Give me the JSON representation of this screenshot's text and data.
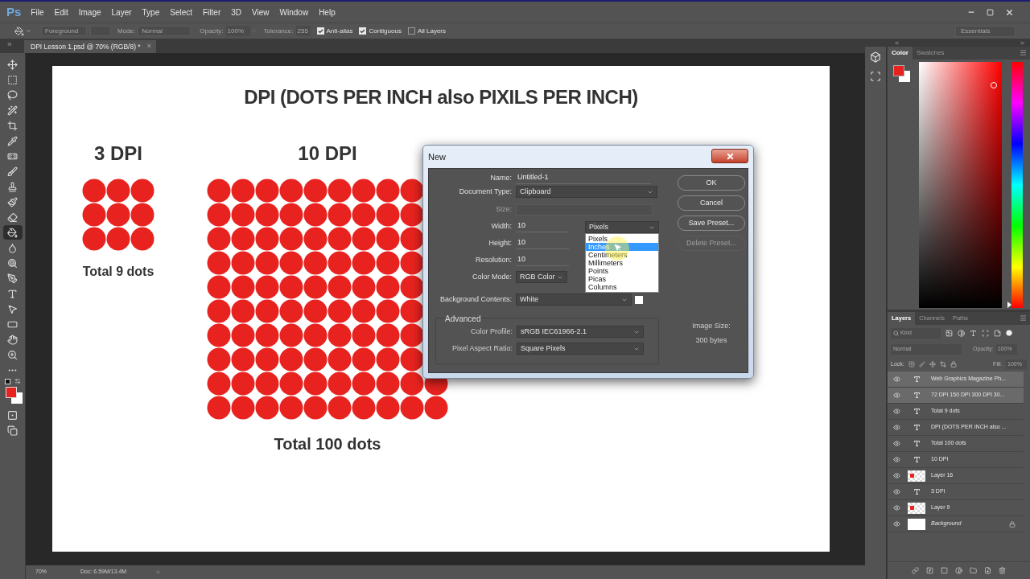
{
  "app": {
    "logo": "Ps",
    "menu": [
      "File",
      "Edit",
      "Image",
      "Layer",
      "Type",
      "Select",
      "Filter",
      "3D",
      "View",
      "Window",
      "Help"
    ]
  },
  "options_bar": {
    "preset": "Foreground",
    "mode_label": "Mode:",
    "mode": "Normal",
    "opacity_label": "Opacity:",
    "opacity": "100%",
    "tolerance_label": "Tolerance:",
    "tolerance": "255",
    "checkboxes": [
      {
        "label": "Anti-alias",
        "checked": true
      },
      {
        "label": "Contiguous",
        "checked": true
      },
      {
        "label": "All Layers",
        "checked": false
      }
    ],
    "workspace": "Essentials"
  },
  "document_tab": {
    "title": "DPI Lesson 1.psd @ 70% (RGB/8) *",
    "close": "×"
  },
  "tools": [
    {
      "kind": "move",
      "selected": false
    },
    {
      "kind": "marquee",
      "selected": false
    },
    {
      "kind": "lasso",
      "selected": false
    },
    {
      "kind": "quick_selection",
      "selected": false
    },
    {
      "kind": "crop",
      "selected": false
    },
    {
      "kind": "eyedropper",
      "selected": false
    },
    {
      "kind": "healing",
      "selected": false
    },
    {
      "kind": "brush",
      "selected": false
    },
    {
      "kind": "stamp",
      "selected": false
    },
    {
      "kind": "history_brush",
      "selected": false
    },
    {
      "kind": "eraser",
      "selected": false
    },
    {
      "kind": "paint_bucket",
      "selected": true
    },
    {
      "kind": "blur",
      "selected": false
    },
    {
      "kind": "dodge",
      "selected": false
    },
    {
      "kind": "pen",
      "selected": false
    },
    {
      "kind": "type",
      "selected": false
    },
    {
      "kind": "path_selection",
      "selected": false
    },
    {
      "kind": "rectangle",
      "selected": false
    },
    {
      "kind": "hand",
      "selected": false
    },
    {
      "kind": "zoom",
      "selected": false
    },
    {
      "kind": "more",
      "selected": false
    },
    {
      "kind": "colors",
      "selected": false
    },
    {
      "kind": "quick_mask",
      "selected": false
    },
    {
      "kind": "screen_mode",
      "selected": false
    }
  ],
  "document": {
    "title": "DPI (DOTS PER INCH also PIXILS PER INCH)",
    "examples": [
      {
        "heading": "3 DPI",
        "kind": "small",
        "total": "Total 9 dots"
      },
      {
        "heading": "10 DPI",
        "kind": "large",
        "total": "Total 100 dots"
      }
    ]
  },
  "dialog": {
    "title": "New",
    "name": {
      "label": "Name:",
      "value": "Untitled-1"
    },
    "document_type": {
      "label": "Document Type:",
      "value": "Clipboard"
    },
    "size": {
      "label": "Size:",
      "disabled": true
    },
    "width": {
      "label": "Width:",
      "value": "10",
      "unit": "Pixels",
      "unit_options": [
        {
          "label": "Pixels",
          "selected": false
        },
        {
          "label": "Inches",
          "selected": true
        },
        {
          "label": "Centimeters",
          "selected": false
        },
        {
          "label": "Millimeters",
          "selected": false
        },
        {
          "label": "Points",
          "selected": false
        },
        {
          "label": "Picas",
          "selected": false
        },
        {
          "label": "Columns",
          "selected": false
        }
      ]
    },
    "height": {
      "label": "Height:",
      "value": "10"
    },
    "resolution": {
      "label": "Resolution:",
      "value": "10"
    },
    "color_mode": {
      "label": "Color Mode:",
      "value": "RGB Color"
    },
    "background": {
      "label": "Background Contents:",
      "value": "White"
    },
    "advanced": {
      "title": "Advanced",
      "color_profile": {
        "label": "Color Profile:",
        "value": "sRGB IEC61966-2.1"
      },
      "pixel_aspect_ratio": {
        "label": "Pixel Aspect Ratio:",
        "value": "Square Pixels"
      }
    },
    "buttons": [
      {
        "label": "OK",
        "disabled": false
      },
      {
        "label": "Cancel",
        "disabled": false
      },
      {
        "label": "Save Preset...",
        "disabled": false
      },
      {
        "label": "Delete Preset...",
        "disabled": true
      }
    ],
    "image_size_label": "Image Size:",
    "image_size": "300 bytes"
  },
  "color_panel": {
    "tabs": [
      {
        "label": "Color",
        "selected": true
      },
      {
        "label": "Swatches",
        "selected": false
      }
    ],
    "hue_slider": {
      "level": 0
    }
  },
  "layers_panel": {
    "tabs": [
      {
        "label": "Layers",
        "selected": true
      },
      {
        "label": "Channels",
        "selected": false
      },
      {
        "label": "Paths",
        "selected": false
      }
    ],
    "filter_placeholder": "Kind",
    "blend_mode": "Normal",
    "opacity_label": "Opacity:",
    "opacity": "100%",
    "lock_label": "Lock:",
    "fill_label": "Fill:",
    "fill": "100%",
    "layers": [
      {
        "name": "Web Graphics Magazine Ph...",
        "kind": "text",
        "selected": true,
        "visible": true
      },
      {
        "name": "72 DPI 150 DPI 300 DPI 30...",
        "kind": "text",
        "selected": true,
        "visible": true
      },
      {
        "name": "Total 9 dots",
        "kind": "text",
        "selected": false,
        "visible": true
      },
      {
        "name": "DPI (DOTS PER INCH also ...",
        "kind": "text",
        "selected": false,
        "visible": true
      },
      {
        "name": "Total 100 dots",
        "kind": "text",
        "selected": false,
        "visible": true
      },
      {
        "name": "10 DPI",
        "kind": "text",
        "selected": false,
        "visible": true
      },
      {
        "name": "Layer 16",
        "kind": "image",
        "selected": false,
        "visible": true
      },
      {
        "name": "3 DPI",
        "kind": "text",
        "selected": false,
        "visible": true
      },
      {
        "name": "Layer 9",
        "kind": "image",
        "selected": false,
        "visible": true
      },
      {
        "name": "Background",
        "kind": "background",
        "selected": false,
        "visible": true
      }
    ]
  },
  "status_bar": {
    "zoom": "70%",
    "doc_info": "Doc: 6.59M/13.4M"
  }
}
